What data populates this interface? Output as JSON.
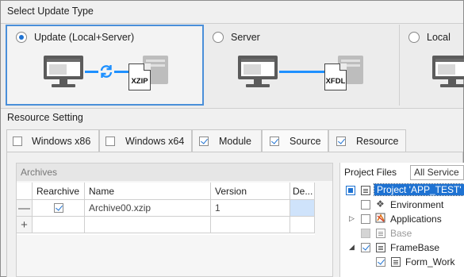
{
  "update_type": {
    "title": "Select Update Type",
    "options": [
      {
        "label": "Update (Local+Server)",
        "selected": true,
        "file_label": "XZIP"
      },
      {
        "label": "Server",
        "selected": false,
        "file_label": "XFDL"
      },
      {
        "label": "Local",
        "selected": false
      }
    ]
  },
  "resource": {
    "title": "Resource Setting",
    "tabs": [
      {
        "label": "Windows x86",
        "checked": false
      },
      {
        "label": "Windows x64",
        "checked": false
      },
      {
        "label": "Module",
        "checked": true
      },
      {
        "label": "Source",
        "checked": true
      },
      {
        "label": "Resource",
        "checked": true
      }
    ],
    "active_tab": "Source"
  },
  "archives": {
    "title": "Archives",
    "columns": [
      "Rearchive",
      "Name",
      "Version",
      "De..."
    ],
    "rows": [
      {
        "row_button": "—",
        "rearchive": true,
        "name": "Archive00.xzip",
        "version": "1",
        "description": ""
      }
    ],
    "add_row_button": "+"
  },
  "project_files": {
    "title": "Project Files",
    "service_filter": "All Service",
    "tree": [
      {
        "label": "Project 'APP_TEST'",
        "state": "partial",
        "selected": true
      },
      {
        "label": "Environment",
        "state": "unchecked"
      },
      {
        "label": "Applications",
        "state": "unchecked",
        "expander": "collapsed"
      },
      {
        "label": "Base",
        "state": "disabled"
      },
      {
        "label": "FrameBase",
        "state": "checked",
        "expander": "expanded"
      },
      {
        "label": "Form_Work",
        "state": "checked"
      }
    ]
  },
  "colors": {
    "accent": "#1e72d2",
    "link_line": "#1e90ff",
    "selected_card_border": "#4a8fd9"
  }
}
